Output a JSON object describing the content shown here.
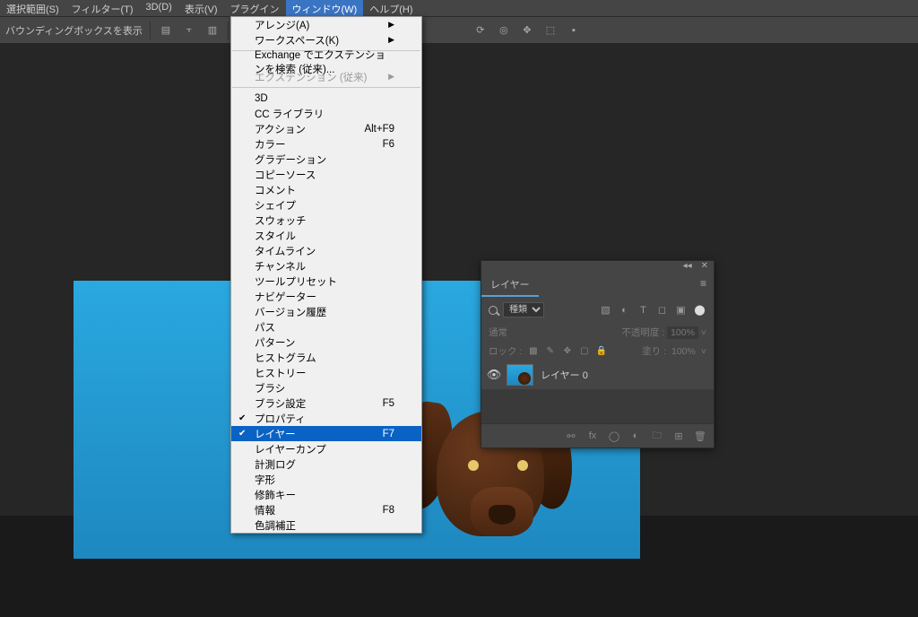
{
  "menubar": {
    "items": [
      {
        "label": "選択範囲(S)"
      },
      {
        "label": "フィルター(T)"
      },
      {
        "label": "3D(D)"
      },
      {
        "label": "表示(V)"
      },
      {
        "label": "プラグイン"
      },
      {
        "label": "ウィンドウ(W)"
      },
      {
        "label": "ヘルプ(H)"
      }
    ],
    "open_index": 5
  },
  "toolbar": {
    "option_label": "バウンディングボックスを表示"
  },
  "dropdown": {
    "groups": [
      [
        {
          "label": "アレンジ(A)",
          "submenu": true
        },
        {
          "label": "ワークスペース(K)",
          "submenu": true
        }
      ],
      [
        {
          "label": "Exchange でエクステンションを検索 (従来)..."
        },
        {
          "label": "エクステンション (従来)",
          "submenu": true,
          "disabled": true
        }
      ],
      [
        {
          "label": "3D"
        },
        {
          "label": "CC ライブラリ"
        },
        {
          "label": "アクション",
          "shortcut": "Alt+F9"
        },
        {
          "label": "カラー",
          "shortcut": "F6"
        },
        {
          "label": "グラデーション"
        },
        {
          "label": "コピーソース"
        },
        {
          "label": "コメント"
        },
        {
          "label": "シェイプ"
        },
        {
          "label": "スウォッチ"
        },
        {
          "label": "スタイル"
        },
        {
          "label": "タイムライン"
        },
        {
          "label": "チャンネル"
        },
        {
          "label": "ツールプリセット"
        },
        {
          "label": "ナビゲーター"
        },
        {
          "label": "バージョン履歴"
        },
        {
          "label": "パス"
        },
        {
          "label": "パターン"
        },
        {
          "label": "ヒストグラム"
        },
        {
          "label": "ヒストリー"
        },
        {
          "label": "ブラシ"
        },
        {
          "label": "ブラシ設定",
          "shortcut": "F5"
        },
        {
          "label": "プロパティ",
          "checked": true
        },
        {
          "label": "レイヤー",
          "shortcut": "F7",
          "checked": true,
          "highlighted": true
        },
        {
          "label": "レイヤーカンプ"
        },
        {
          "label": "計測ログ"
        },
        {
          "label": "字形"
        },
        {
          "label": "修飾キー"
        },
        {
          "label": "情報",
          "shortcut": "F8"
        },
        {
          "label": "色調補正"
        }
      ]
    ]
  },
  "layers_panel": {
    "tab_label": "レイヤー",
    "filter_label": "種類",
    "blend_mode": "通常",
    "opacity_label": "不透明度 :",
    "opacity_value": "100%",
    "lock_label": "ロック :",
    "fill_label": "塗り :",
    "fill_value": "100%",
    "rows": [
      {
        "name": "レイヤー 0"
      }
    ]
  }
}
